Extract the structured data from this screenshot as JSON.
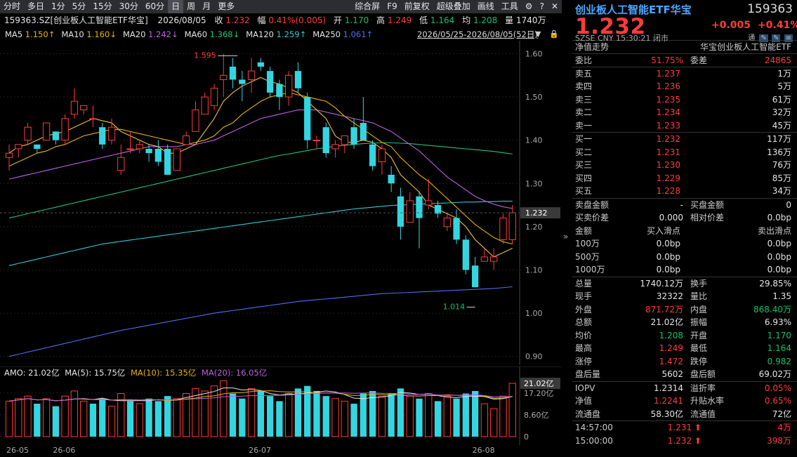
{
  "toolbar": {
    "periods": [
      "分时",
      "多日",
      "1分",
      "5分",
      "15分",
      "30分",
      "60分",
      "日",
      "周",
      "月",
      "更多"
    ],
    "active_period": "日",
    "tools": [
      "综合屏",
      "F9",
      "前复权",
      "超级叠加",
      "画线",
      "工具"
    ]
  },
  "quote_line": {
    "name": "159363.SZ[创业板人工智能ETF华宝]",
    "date": "2026/08/05",
    "close_label": "收",
    "close": "1.232",
    "range_label": "幅",
    "range": "0.41%(0.005)",
    "open_label": "开",
    "open": "1.170",
    "high_label": "高",
    "high": "1.249",
    "low_label": "低",
    "low": "1.164",
    "avg_label": "均",
    "avg": "1.208",
    "vol_label": "量",
    "vol": "1740万"
  },
  "ma_legend": [
    {
      "label": "MA5",
      "value": "1.150↑",
      "color": "#e8b400"
    },
    {
      "label": "MA10",
      "value": "1.160↓",
      "color": "#e8b400"
    },
    {
      "label": "MA20",
      "value": "1.242↓",
      "color": "#c060e0"
    },
    {
      "label": "MA60",
      "value": "1.368↓",
      "color": "#22c27a"
    },
    {
      "label": "MA120",
      "value": "1.259↑",
      "color": "#33c7d6"
    },
    {
      "label": "MA250",
      "value": "1.061↑",
      "color": "#4f6ef0"
    }
  ],
  "date_range": "2026/05/25-2026/08/05(52日)",
  "y_axis": [
    "1.60",
    "1.50",
    "1.40",
    "1.30",
    "1.20",
    "1.10",
    "1.00",
    "0.90"
  ],
  "price_tag": "1.232",
  "annot_high": "1.595",
  "annot_low": "1.014",
  "volume": {
    "header": "AMO: 21.02亿  MA(5): 15.75亿  MA(10): 15.35亿  MA(20): 16.05亿",
    "amo": "AMO: 21.02亿",
    "ma5": "MA(5): 15.75亿",
    "ma10": "MA(10): 15.35亿",
    "ma20": "MA(20): 16.05亿",
    "axis": [
      "21.02亿",
      "17.20亿",
      "8.60亿",
      "0"
    ]
  },
  "x_ticks": [
    "26-05",
    "26-06",
    "26-07",
    "26-08"
  ],
  "panel": {
    "name": "创业板人工智能ETF华宝",
    "code": "159363",
    "price": "1.232",
    "change": "+0.005",
    "pct": "+0.41%",
    "meta": "SZSE  CNY  15:30:21  闭市",
    "trend_label": "净值走势",
    "trend_name": "华宝创业板人工智能ETF",
    "ratio": {
      "l1": "委比",
      "v1": "51.75%",
      "l2": "委差",
      "v2": "24865"
    },
    "asks": [
      {
        "label": "卖五",
        "price": "1.237",
        "vol": "1万"
      },
      {
        "label": "卖四",
        "price": "1.236",
        "vol": "5万"
      },
      {
        "label": "卖三",
        "price": "1.235",
        "vol": "61万"
      },
      {
        "label": "卖二",
        "price": "1.234",
        "vol": "32万"
      },
      {
        "label": "卖一",
        "price": "1.233",
        "vol": "45万"
      }
    ],
    "bids": [
      {
        "label": "买一",
        "price": "1.232",
        "vol": "117万"
      },
      {
        "label": "买二",
        "price": "1.231",
        "vol": "136万"
      },
      {
        "label": "买三",
        "price": "1.230",
        "vol": "76万"
      },
      {
        "label": "买四",
        "price": "1.229",
        "vol": "85万"
      },
      {
        "label": "买五",
        "price": "1.228",
        "vol": "34万"
      }
    ],
    "amt": [
      {
        "l1": "卖盘金额",
        "v1": "-",
        "l2": "买盘金额",
        "v2": "0"
      },
      {
        "l1": "买卖价差",
        "v1": "0.000",
        "l2": "相对价差",
        "v2": "0.0bp"
      }
    ],
    "slip_header": {
      "a": "金额",
      "b": "买入滑点",
      "c": "卖出滑点"
    },
    "slip": [
      {
        "a": "100万",
        "b": "0.0bp",
        "c": "0.0bp"
      },
      {
        "a": "500万",
        "b": "0.0bp",
        "c": "0.0bp"
      },
      {
        "a": "1000万",
        "b": "0.0bp",
        "c": "0.0bp"
      }
    ],
    "stats": [
      {
        "l1": "总量",
        "v1": "1740.12万",
        "c1": "wh",
        "l2": "换手",
        "v2": "29.85%",
        "c2": "wh"
      },
      {
        "l1": "现手",
        "v1": "32322",
        "c1": "wh",
        "l2": "量比",
        "v2": "1.35",
        "c2": "wh"
      },
      {
        "l1": "外盘",
        "v1": "871.72万",
        "c1": "red",
        "l2": "内盘",
        "v2": "868.40万",
        "c2": "grn"
      },
      {
        "l1": "总额",
        "v1": "21.02亿",
        "c1": "wh",
        "l2": "振幅",
        "v2": "6.93%",
        "c2": "wh"
      },
      {
        "l1": "均价",
        "v1": "1.208",
        "c1": "grn",
        "l2": "开盘",
        "v2": "1.170",
        "c2": "grn"
      },
      {
        "l1": "最高",
        "v1": "1.249",
        "c1": "red",
        "l2": "最低",
        "v2": "1.164",
        "c2": "grn"
      },
      {
        "l1": "涨停",
        "v1": "1.472",
        "c1": "red",
        "l2": "跌停",
        "v2": "0.982",
        "c2": "grn"
      },
      {
        "l1": "盘后量",
        "v1": "5602",
        "c1": "wh",
        "l2": "盘后额",
        "v2": "69.02万",
        "c2": "wh"
      }
    ],
    "nav": [
      {
        "l1": "IOPV",
        "v1": "1.2314",
        "c1": "wh",
        "l2": "溢折率",
        "v2": "0.05%",
        "c2": "red"
      },
      {
        "l1": "净值",
        "v1": "1.2241",
        "c1": "red",
        "l2": "升贴水率",
        "v2": "0.65%",
        "c2": "red"
      },
      {
        "l1": "流通盘",
        "v1": "58.30亿",
        "c1": "wh",
        "l2": "流通值",
        "v2": "72亿",
        "c2": "wh"
      }
    ],
    "ticks": [
      {
        "time": "14:57:00",
        "price": "1.231",
        "vol": "4万"
      },
      {
        "time": "15:00:00",
        "price": "1.232",
        "vol": "398万"
      }
    ]
  },
  "chart_data": {
    "type": "candlestick",
    "ylim": [
      0.88,
      1.63
    ],
    "candles": [
      [
        1.36,
        1.39,
        1.33,
        1.37
      ],
      [
        1.38,
        1.39,
        1.36,
        1.39
      ],
      [
        1.4,
        1.44,
        1.39,
        1.43
      ],
      [
        1.39,
        1.39,
        1.37,
        1.38
      ],
      [
        1.4,
        1.44,
        1.4,
        1.44
      ],
      [
        1.42,
        1.42,
        1.39,
        1.4
      ],
      [
        1.4,
        1.46,
        1.39,
        1.45
      ],
      [
        1.46,
        1.52,
        1.45,
        1.49
      ],
      [
        1.47,
        1.48,
        1.46,
        1.48
      ],
      [
        1.45,
        1.48,
        1.43,
        1.45
      ],
      [
        1.43,
        1.44,
        1.38,
        1.39
      ],
      [
        1.4,
        1.45,
        1.39,
        1.43
      ],
      [
        1.33,
        1.39,
        1.32,
        1.36
      ],
      [
        1.38,
        1.42,
        1.37,
        1.38
      ],
      [
        1.38,
        1.4,
        1.37,
        1.39
      ],
      [
        1.38,
        1.39,
        1.35,
        1.37
      ],
      [
        1.38,
        1.4,
        1.34,
        1.35
      ],
      [
        1.38,
        1.39,
        1.32,
        1.32
      ],
      [
        1.33,
        1.38,
        1.33,
        1.38
      ],
      [
        1.39,
        1.42,
        1.39,
        1.41
      ],
      [
        1.42,
        1.49,
        1.42,
        1.47
      ],
      [
        1.46,
        1.51,
        1.46,
        1.5
      ],
      [
        1.48,
        1.53,
        1.47,
        1.52
      ],
      [
        1.54,
        1.6,
        1.5,
        1.55
      ],
      [
        1.57,
        1.59,
        1.52,
        1.54
      ],
      [
        1.54,
        1.56,
        1.49,
        1.53
      ],
      [
        1.54,
        1.59,
        1.51,
        1.56
      ],
      [
        1.58,
        1.59,
        1.56,
        1.57
      ],
      [
        1.56,
        1.57,
        1.5,
        1.51
      ],
      [
        1.53,
        1.54,
        1.47,
        1.5
      ],
      [
        1.5,
        1.56,
        1.48,
        1.55
      ],
      [
        1.56,
        1.58,
        1.51,
        1.52
      ],
      [
        1.5,
        1.51,
        1.38,
        1.4
      ],
      [
        1.4,
        1.41,
        1.38,
        1.4
      ],
      [
        1.43,
        1.44,
        1.36,
        1.37
      ],
      [
        1.38,
        1.4,
        1.36,
        1.39
      ],
      [
        1.39,
        1.41,
        1.37,
        1.41
      ],
      [
        1.43,
        1.45,
        1.38,
        1.39
      ],
      [
        1.44,
        1.5,
        1.4,
        1.4
      ],
      [
        1.39,
        1.4,
        1.33,
        1.34
      ],
      [
        1.35,
        1.39,
        1.32,
        1.38
      ],
      [
        1.32,
        1.34,
        1.28,
        1.3
      ],
      [
        1.27,
        1.29,
        1.17,
        1.2
      ],
      [
        1.21,
        1.28,
        1.21,
        1.26
      ],
      [
        1.27,
        1.28,
        1.15,
        1.22
      ],
      [
        1.25,
        1.31,
        1.24,
        1.26
      ],
      [
        1.25,
        1.26,
        1.22,
        1.23
      ],
      [
        1.2,
        1.23,
        1.19,
        1.22
      ],
      [
        1.22,
        1.24,
        1.16,
        1.17
      ],
      [
        1.17,
        1.18,
        1.09,
        1.1
      ],
      [
        1.11,
        1.13,
        1.06,
        1.06
      ],
      [
        1.12,
        1.15,
        1.12,
        1.13
      ],
      [
        1.12,
        1.15,
        1.1,
        1.13
      ],
      [
        1.17,
        1.23,
        1.16,
        1.22
      ],
      [
        1.17,
        1.25,
        1.16,
        1.232
      ]
    ],
    "ma5": [
      1.37,
      1.385,
      1.39,
      1.4,
      1.41,
      1.415,
      1.42,
      1.43,
      1.44,
      1.45,
      1.445,
      1.44,
      1.42,
      1.41,
      1.4,
      1.39,
      1.385,
      1.37,
      1.37,
      1.38,
      1.39,
      1.42,
      1.45,
      1.49,
      1.51,
      1.525,
      1.535,
      1.545,
      1.535,
      1.53,
      1.52,
      1.51,
      1.49,
      1.47,
      1.45,
      1.41,
      1.395,
      1.395,
      1.4,
      1.395,
      1.38,
      1.36,
      1.32,
      1.3,
      1.28,
      1.25,
      1.24,
      1.23,
      1.22,
      1.2,
      1.17,
      1.15,
      1.13,
      1.14,
      1.15
    ],
    "ma10": [
      1.34,
      1.35,
      1.36,
      1.37,
      1.375,
      1.385,
      1.39,
      1.4,
      1.41,
      1.415,
      1.42,
      1.425,
      1.425,
      1.42,
      1.415,
      1.41,
      1.405,
      1.4,
      1.395,
      1.39,
      1.395,
      1.4,
      1.41,
      1.43,
      1.44,
      1.46,
      1.475,
      1.49,
      1.5,
      1.505,
      1.51,
      1.505,
      1.5,
      1.495,
      1.49,
      1.475,
      1.455,
      1.44,
      1.425,
      1.41,
      1.395,
      1.385,
      1.36,
      1.34,
      1.32,
      1.305,
      1.285,
      1.265,
      1.245,
      1.225,
      1.205,
      1.19,
      1.175,
      1.165,
      1.16
    ],
    "ma20": [
      1.31,
      1.315,
      1.32,
      1.325,
      1.33,
      1.335,
      1.34,
      1.345,
      1.35,
      1.355,
      1.36,
      1.365,
      1.37,
      1.375,
      1.38,
      1.385,
      1.385,
      1.385,
      1.385,
      1.39,
      1.39,
      1.395,
      1.4,
      1.41,
      1.42,
      1.43,
      1.44,
      1.45,
      1.455,
      1.46,
      1.465,
      1.47,
      1.47,
      1.47,
      1.465,
      1.46,
      1.455,
      1.45,
      1.445,
      1.44,
      1.43,
      1.42,
      1.405,
      1.39,
      1.375,
      1.355,
      1.335,
      1.315,
      1.3,
      1.285,
      1.27,
      1.26,
      1.252,
      1.246,
      1.242
    ],
    "ma60": [
      1.22,
      1.225,
      1.23,
      1.235,
      1.24,
      1.245,
      1.25,
      1.255,
      1.26,
      1.265,
      1.27,
      1.275,
      1.28,
      1.285,
      1.29,
      1.295,
      1.3,
      1.305,
      1.31,
      1.315,
      1.32,
      1.325,
      1.33,
      1.335,
      1.34,
      1.345,
      1.35,
      1.355,
      1.36,
      1.365,
      1.368,
      1.372,
      1.376,
      1.38,
      1.383,
      1.386,
      1.388,
      1.39,
      1.392,
      1.393,
      1.394,
      1.394,
      1.393,
      1.392,
      1.39,
      1.388,
      1.386,
      1.384,
      1.382,
      1.38,
      1.378,
      1.376,
      1.374,
      1.371,
      1.368
    ],
    "ma120": [
      1.11,
      1.115,
      1.12,
      1.125,
      1.13,
      1.135,
      1.14,
      1.145,
      1.15,
      1.155,
      1.16,
      1.163,
      1.166,
      1.169,
      1.172,
      1.175,
      1.178,
      1.181,
      1.184,
      1.187,
      1.19,
      1.193,
      1.196,
      1.199,
      1.202,
      1.205,
      1.208,
      1.211,
      1.214,
      1.217,
      1.22,
      1.223,
      1.226,
      1.229,
      1.232,
      1.235,
      1.238,
      1.241,
      1.243,
      1.245,
      1.247,
      1.249,
      1.25,
      1.251,
      1.252,
      1.253,
      1.254,
      1.255,
      1.256,
      1.257,
      1.257,
      1.258,
      1.258,
      1.259,
      1.259
    ],
    "ma250": [
      0.9,
      0.905,
      0.91,
      0.915,
      0.92,
      0.925,
      0.93,
      0.935,
      0.94,
      0.945,
      0.95,
      0.955,
      0.96,
      0.964,
      0.968,
      0.972,
      0.976,
      0.98,
      0.984,
      0.988,
      0.992,
      0.996,
      1.0,
      1.003,
      1.006,
      1.009,
      1.012,
      1.015,
      1.018,
      1.021,
      1.024,
      1.027,
      1.029,
      1.031,
      1.033,
      1.035,
      1.037,
      1.039,
      1.041,
      1.043,
      1.045,
      1.046,
      1.047,
      1.048,
      1.049,
      1.05,
      1.051,
      1.052,
      1.053,
      1.054,
      1.055,
      1.056,
      1.057,
      1.059,
      1.061
    ],
    "amount_yi": [
      14,
      15,
      16,
      13,
      15,
      12,
      16,
      18,
      14,
      13,
      15,
      12,
      17,
      14,
      13,
      15,
      14,
      16,
      15,
      17,
      19,
      18,
      20,
      22,
      17,
      15,
      19,
      18,
      16,
      14,
      17,
      19,
      20,
      18,
      16,
      15,
      14,
      13,
      17,
      18,
      16,
      17,
      19,
      16,
      15,
      17,
      14,
      16,
      15,
      17,
      18,
      13,
      11,
      16,
      21.02
    ],
    "up_flags": [
      1,
      1,
      1,
      0,
      1,
      0,
      1,
      1,
      1,
      0,
      0,
      1,
      1,
      0,
      1,
      0,
      0,
      0,
      1,
      1,
      1,
      1,
      1,
      1,
      0,
      0,
      1,
      0,
      0,
      0,
      1,
      0,
      0,
      0,
      0,
      1,
      1,
      0,
      0,
      0,
      1,
      0,
      0,
      1,
      0,
      1,
      0,
      1,
      0,
      0,
      0,
      1,
      1,
      1,
      1
    ]
  }
}
